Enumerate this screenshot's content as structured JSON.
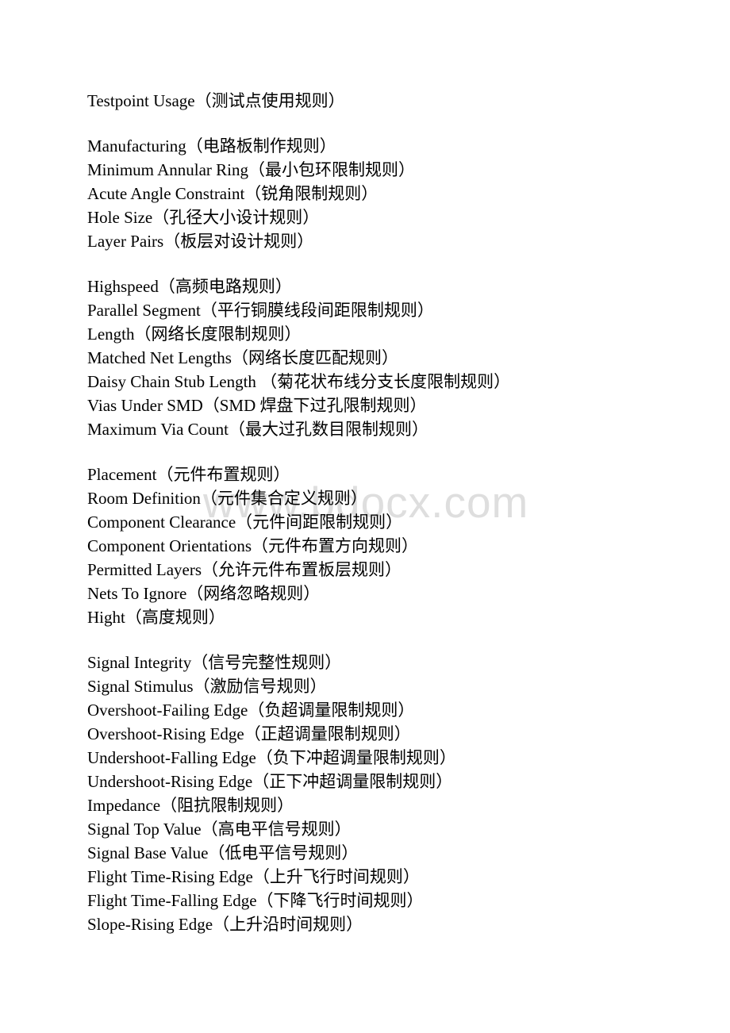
{
  "watermark": "www.bdocx.com",
  "sections": [
    {
      "items": [
        "Testpoint Usage（测试点使用规则）"
      ]
    },
    {
      "items": [
        "Manufacturing（电路板制作规则）",
        "Minimum Annular Ring（最小包环限制规则）",
        "Acute Angle Constraint（锐角限制规则）",
        "Hole Size（孔径大小设计规则）",
        "Layer Pairs（板层对设计规则）"
      ]
    },
    {
      "items": [
        "Highspeed（高频电路规则）",
        "Parallel Segment（平行铜膜线段间距限制规则）",
        "Length（网络长度限制规则）",
        "Matched Net Lengths（网络长度匹配规则）",
        "Daisy Chain Stub Length （菊花状布线分支长度限制规则）",
        "Vias Under SMD（SMD 焊盘下过孔限制规则）",
        "Maximum Via Count（最大过孔数目限制规则）"
      ]
    },
    {
      "items": [
        "Placement（元件布置规则）",
        "Room Definition（元件集合定义规则）",
        "Component Clearance（元件间距限制规则）",
        "Component Orientations（元件布置方向规则）",
        "Permitted Layers（允许元件布置板层规则）",
        "Nets To Ignore（网络忽略规则）",
        "Hight（高度规则）"
      ]
    },
    {
      "items": [
        "Signal Integrity（信号完整性规则）",
        "Signal Stimulus（激励信号规则）",
        "Overshoot-Failing Edge（负超调量限制规则）",
        "Overshoot-Rising Edge（正超调量限制规则）",
        "Undershoot-Falling Edge（负下冲超调量限制规则）",
        "Undershoot-Rising Edge（正下冲超调量限制规则）",
        "Impedance（阻抗限制规则）",
        "Signal Top Value（高电平信号规则）",
        "Signal Base Value（低电平信号规则）",
        "Flight Time-Rising Edge（上升飞行时间规则）",
        "Flight Time-Falling Edge（下降飞行时间规则）",
        "Slope-Rising Edge（上升沿时间规则）"
      ]
    }
  ]
}
